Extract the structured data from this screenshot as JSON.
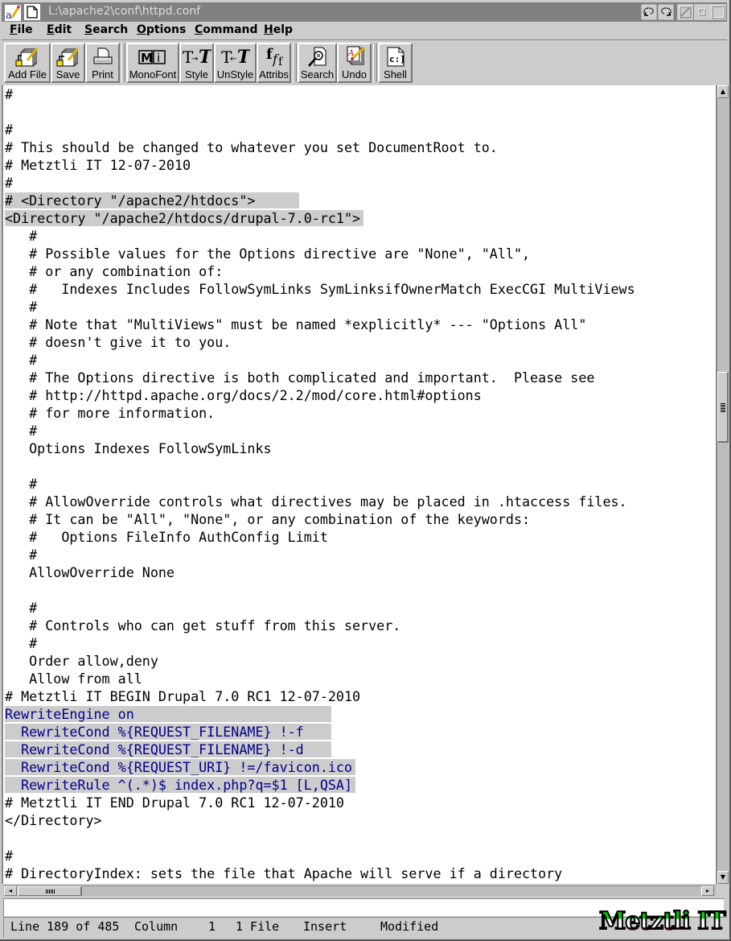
{
  "window": {
    "title": "L:\\apache2\\conf\\httpd.conf",
    "controls": [
      "undo-icon",
      "redo-icon",
      "restore-icon",
      "minimize-icon",
      "maximize-icon"
    ]
  },
  "menu": [
    {
      "label": "File",
      "accel": "F",
      "rest": "ile"
    },
    {
      "label": "Edit",
      "accel": "E",
      "rest": "dit"
    },
    {
      "label": "Search",
      "accel": "S",
      "rest": "earch"
    },
    {
      "label": "Options",
      "accel": "O",
      "rest": "ptions"
    },
    {
      "label": "Command",
      "accel": "C",
      "rest": "ommand"
    },
    {
      "label": "Help",
      "accel": "H",
      "rest": "elp"
    }
  ],
  "toolbar": [
    {
      "label": "Add File",
      "icon": "add-file-icon"
    },
    {
      "label": "Save",
      "icon": "save-icon"
    },
    {
      "label": "Print",
      "icon": "print-icon"
    },
    {
      "label": "MonoFont",
      "icon": "monofont-icon",
      "glyph": "M|i"
    },
    {
      "label": "Style",
      "icon": "style-icon",
      "glyph": "T→T"
    },
    {
      "label": "UnStyle",
      "icon": "unstyle-icon",
      "glyph": "T←T"
    },
    {
      "label": "Attribs",
      "icon": "attribs-icon",
      "glyph": "fff"
    },
    {
      "label": "Search",
      "icon": "search-icon"
    },
    {
      "label": "Undo",
      "icon": "undo-icon"
    },
    {
      "label": "Shell",
      "icon": "shell-icon",
      "glyph": "c:]"
    }
  ],
  "editor": {
    "lines": [
      {
        "text": "#",
        "hl": false,
        "blue": false
      },
      {
        "text": "",
        "hl": false,
        "blue": false
      },
      {
        "text": "#",
        "hl": false,
        "blue": false
      },
      {
        "text": "# This should be changed to whatever you set DocumentRoot to.",
        "hl": false,
        "blue": false
      },
      {
        "text": "# Metztli IT 12-07-2010",
        "hl": false,
        "blue": false
      },
      {
        "text": "#",
        "hl": false,
        "blue": false
      },
      {
        "text": "# <Directory \"/apache2/htdocs\">     ",
        "hl": true,
        "blue": false
      },
      {
        "text": "<Directory \"/apache2/htdocs/drupal-7.0-rc1\">",
        "hl": true,
        "blue": false
      },
      {
        "text": "   #",
        "hl": false,
        "blue": false
      },
      {
        "text": "   # Possible values for the Options directive are \"None\", \"All\",",
        "hl": false,
        "blue": false
      },
      {
        "text": "   # or any combination of:",
        "hl": false,
        "blue": false
      },
      {
        "text": "   #   Indexes Includes FollowSymLinks SymLinksifOwnerMatch ExecCGI MultiViews",
        "hl": false,
        "blue": false
      },
      {
        "text": "   #",
        "hl": false,
        "blue": false
      },
      {
        "text": "   # Note that \"MultiViews\" must be named *explicitly* --- \"Options All\"",
        "hl": false,
        "blue": false
      },
      {
        "text": "   # doesn't give it to you.",
        "hl": false,
        "blue": false
      },
      {
        "text": "   #",
        "hl": false,
        "blue": false
      },
      {
        "text": "   # The Options directive is both complicated and important.  Please see",
        "hl": false,
        "blue": false
      },
      {
        "text": "   # http://httpd.apache.org/docs/2.2/mod/core.html#options",
        "hl": false,
        "blue": false
      },
      {
        "text": "   # for more information.",
        "hl": false,
        "blue": false
      },
      {
        "text": "   #",
        "hl": false,
        "blue": false
      },
      {
        "text": "   Options Indexes FollowSymLinks",
        "hl": false,
        "blue": false
      },
      {
        "text": "",
        "hl": false,
        "blue": false
      },
      {
        "text": "   #",
        "hl": false,
        "blue": false
      },
      {
        "text": "   # AllowOverride controls what directives may be placed in .htaccess files.",
        "hl": false,
        "blue": false
      },
      {
        "text": "   # It can be \"All\", \"None\", or any combination of the keywords:",
        "hl": false,
        "blue": false
      },
      {
        "text": "   #   Options FileInfo AuthConfig Limit",
        "hl": false,
        "blue": false
      },
      {
        "text": "   #",
        "hl": false,
        "blue": false
      },
      {
        "text": "   AllowOverride None",
        "hl": false,
        "blue": false
      },
      {
        "text": "",
        "hl": false,
        "blue": false
      },
      {
        "text": "   #",
        "hl": false,
        "blue": false
      },
      {
        "text": "   # Controls who can get stuff from this server.",
        "hl": false,
        "blue": false
      },
      {
        "text": "   #",
        "hl": false,
        "blue": false
      },
      {
        "text": "   Order allow,deny",
        "hl": false,
        "blue": false
      },
      {
        "text": "   Allow from all",
        "hl": false,
        "blue": false
      },
      {
        "text": "# Metztli IT BEGIN Drupal 7.0 RC1 12-07-2010",
        "hl": false,
        "blue": false
      },
      {
        "text": "RewriteEngine on                        ",
        "hl": true,
        "blue": true
      },
      {
        "text": "  RewriteCond %{REQUEST_FILENAME} !-f   ",
        "hl": true,
        "blue": true
      },
      {
        "text": "  RewriteCond %{REQUEST_FILENAME} !-d   ",
        "hl": true,
        "blue": true
      },
      {
        "text": "  RewriteCond %{REQUEST_URI} !=/favicon.ico",
        "hl": true,
        "blue": true
      },
      {
        "text": "  RewriteRule ^(.*)$ index.php?q=$1 [L,QSA]",
        "hl": true,
        "blue": true
      },
      {
        "text": "# Metztli IT END Drupal 7.0 RC1 12-07-2010",
        "hl": false,
        "blue": false
      },
      {
        "text": "</Directory>",
        "hl": false,
        "blue": false
      },
      {
        "text": "",
        "hl": false,
        "blue": false
      },
      {
        "text": "#",
        "hl": false,
        "blue": false
      },
      {
        "text": "# DirectoryIndex: sets the file that Apache will serve if a directory",
        "hl": false,
        "blue": false
      }
    ]
  },
  "scroll": {
    "vertical_position_fraction": 0.39,
    "horizontal_position_fraction": 0.0
  },
  "command_input": {
    "value": ""
  },
  "status": {
    "line": "Line 189 of 485",
    "column_label": "Column",
    "column_value": "1",
    "files": "1 File",
    "mode": "Insert",
    "modified": "Modified"
  },
  "branding": {
    "logo_text": "Metztli IT",
    "colors": {
      "green": "#00d000",
      "white": "#ffffff",
      "red": "#e00000"
    }
  },
  "colors": {
    "highlight_bg": "#cccccc",
    "rewrite_text": "#00008b",
    "titlebar_bg": "#808080"
  }
}
